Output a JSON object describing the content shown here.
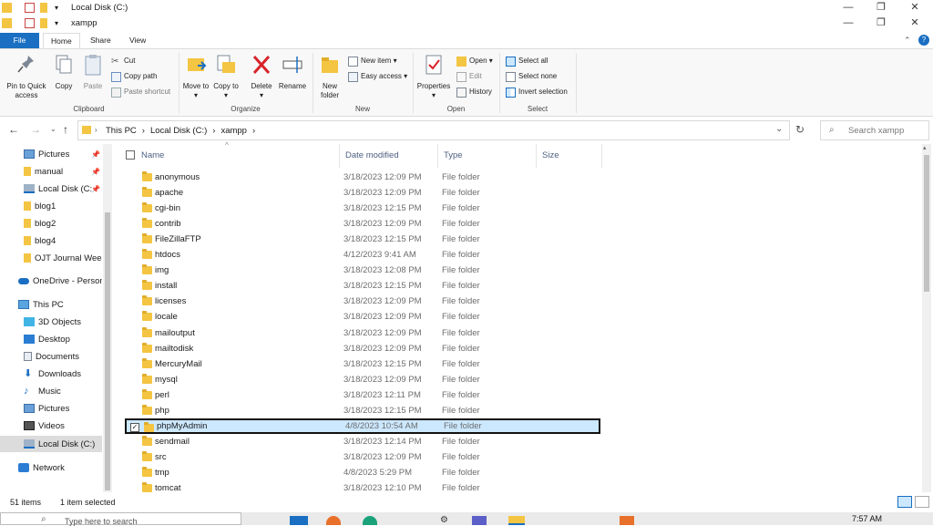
{
  "window": {
    "title_back": "Local Disk (C:)",
    "title_front": "xampp",
    "min_glyph": "—",
    "max_glyph": "❐",
    "close_glyph": "✕"
  },
  "tabs": [
    "File",
    "Home",
    "Share",
    "View"
  ],
  "ribbon": {
    "clipboard": {
      "label": "Clipboard",
      "pin": "Pin to Quick access",
      "copy": "Copy",
      "paste": "Paste",
      "cut": "Cut",
      "copy_path": "Copy path",
      "paste_shortcut": "Paste shortcut"
    },
    "organize": {
      "label": "Organize",
      "move_to": "Move to",
      "copy_to": "Copy to",
      "delete": "Delete",
      "rename": "Rename"
    },
    "new": {
      "label": "New",
      "new_folder": "New folder",
      "new_item": "New item",
      "easy_access": "Easy access"
    },
    "open": {
      "label": "Open",
      "properties": "Properties",
      "open": "Open",
      "edit": "Edit",
      "history": "History"
    },
    "select": {
      "label": "Select",
      "select_all": "Select all",
      "select_none": "Select none",
      "invert": "Invert selection"
    }
  },
  "address": {
    "crumbs": [
      "This PC",
      "Local Disk (C:)",
      "xampp"
    ],
    "search_placeholder": "Search xampp"
  },
  "sidebar": {
    "items": [
      {
        "label": "Pictures",
        "pinned": true
      },
      {
        "label": "manual",
        "pinned": true
      },
      {
        "label": "Local Disk (C:",
        "pinned": true
      },
      {
        "label": "blog1"
      },
      {
        "label": "blog2"
      },
      {
        "label": "blog4"
      },
      {
        "label": "OJT Journal Wee"
      },
      {
        "label": "OneDrive - Person"
      },
      {
        "label": "This PC"
      },
      {
        "label": "3D Objects"
      },
      {
        "label": "Desktop"
      },
      {
        "label": "Documents"
      },
      {
        "label": "Downloads"
      },
      {
        "label": "Music"
      },
      {
        "label": "Pictures"
      },
      {
        "label": "Videos"
      },
      {
        "label": "Local Disk (C:)"
      },
      {
        "label": "Network"
      }
    ]
  },
  "columns": {
    "name": "Name",
    "date": "Date modified",
    "type": "Type",
    "size": "Size"
  },
  "files": [
    {
      "name": "anonymous",
      "date": "3/18/2023 12:09 PM",
      "type": "File folder"
    },
    {
      "name": "apache",
      "date": "3/18/2023 12:09 PM",
      "type": "File folder"
    },
    {
      "name": "cgi-bin",
      "date": "3/18/2023 12:15 PM",
      "type": "File folder"
    },
    {
      "name": "contrib",
      "date": "3/18/2023 12:09 PM",
      "type": "File folder"
    },
    {
      "name": "FileZillaFTP",
      "date": "3/18/2023 12:15 PM",
      "type": "File folder"
    },
    {
      "name": "htdocs",
      "date": "4/12/2023 9:41 AM",
      "type": "File folder"
    },
    {
      "name": "img",
      "date": "3/18/2023 12:08 PM",
      "type": "File folder"
    },
    {
      "name": "install",
      "date": "3/18/2023 12:15 PM",
      "type": "File folder"
    },
    {
      "name": "licenses",
      "date": "3/18/2023 12:09 PM",
      "type": "File folder"
    },
    {
      "name": "locale",
      "date": "3/18/2023 12:09 PM",
      "type": "File folder"
    },
    {
      "name": "mailoutput",
      "date": "3/18/2023 12:09 PM",
      "type": "File folder"
    },
    {
      "name": "mailtodisk",
      "date": "3/18/2023 12:09 PM",
      "type": "File folder"
    },
    {
      "name": "MercuryMail",
      "date": "3/18/2023 12:15 PM",
      "type": "File folder"
    },
    {
      "name": "mysql",
      "date": "3/18/2023 12:09 PM",
      "type": "File folder"
    },
    {
      "name": "perl",
      "date": "3/18/2023 12:11 PM",
      "type": "File folder"
    },
    {
      "name": "php",
      "date": "3/18/2023 12:15 PM",
      "type": "File folder"
    },
    {
      "name": "phpMyAdmin",
      "date": "4/8/2023 10:54 AM",
      "type": "File folder",
      "selected": true
    },
    {
      "name": "sendmail",
      "date": "3/18/2023 12:14 PM",
      "type": "File folder"
    },
    {
      "name": "src",
      "date": "3/18/2023 12:09 PM",
      "type": "File folder"
    },
    {
      "name": "tmp",
      "date": "4/8/2023 5:29 PM",
      "type": "File folder"
    },
    {
      "name": "tomcat",
      "date": "3/18/2023 12:10 PM",
      "type": "File folder"
    }
  ],
  "status": {
    "count": "51 items",
    "selected": "1 item selected"
  },
  "taskbar": {
    "search_placeholder": "Type here to search",
    "time": "7:57 AM"
  },
  "colors": {
    "accent": "#1a6fc2",
    "selection": "#cce8ff",
    "folder": "#f4c542"
  }
}
